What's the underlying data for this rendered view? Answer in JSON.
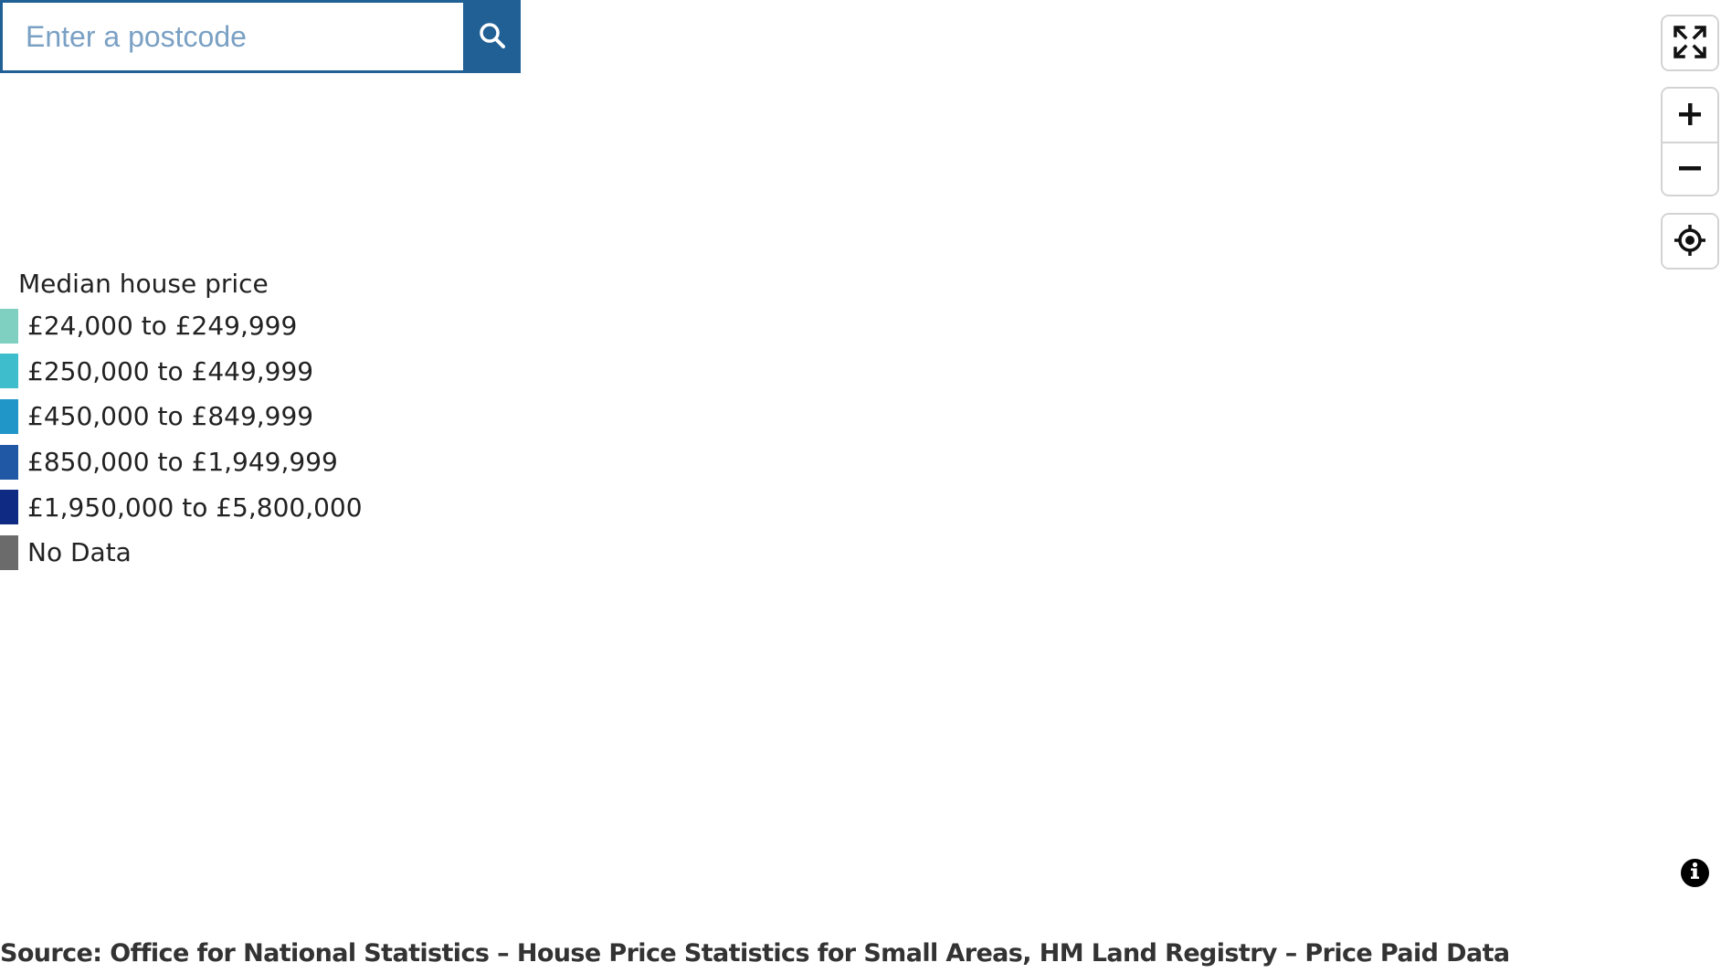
{
  "search": {
    "placeholder": "Enter a postcode",
    "value": "",
    "button_icon": "search-icon"
  },
  "controls": {
    "fullscreen_icon": "fullscreen-icon",
    "zoom_in_icon": "plus-icon",
    "zoom_out_icon": "minus-icon",
    "locate_icon": "locate-icon"
  },
  "legend": {
    "title": "Median house price",
    "items": [
      {
        "label": "£24,000 to £249,999",
        "color": "#7fd0c0"
      },
      {
        "label": "£250,000 to £449,999",
        "color": "#3ebdcd"
      },
      {
        "label": "£450,000 to £849,999",
        "color": "#1f95c8"
      },
      {
        "label": "£850,000 to £1,949,999",
        "color": "#2158a6"
      },
      {
        "label": "£1,950,000 to £5,800,000",
        "color": "#0e2a83"
      },
      {
        "label": "No Data",
        "color": "#6b6b6b"
      }
    ]
  },
  "info": {
    "icon": "info-icon"
  },
  "source": "Source: Office for National Statistics – House Price Statistics for Small Areas, HM Land Registry – Price Paid Data",
  "colors": {
    "accent": "#206095"
  }
}
